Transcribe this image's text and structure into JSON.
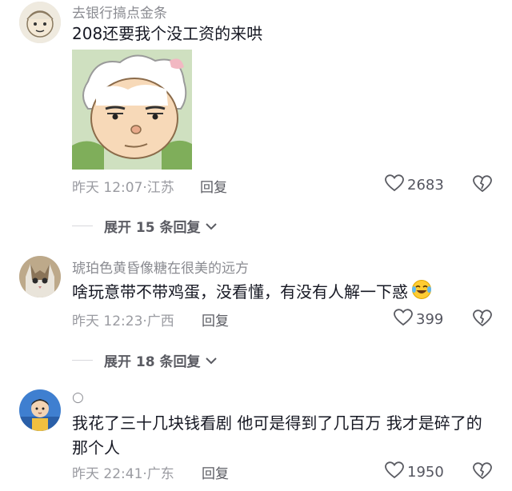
{
  "comments": [
    {
      "username": "去银行搞点金条",
      "text": "208还要我个没工资的来哄",
      "time_location": "昨天 12:07·江苏",
      "reply_label": "回复",
      "likes": "2683",
      "expand_label": "展开 15 条回复"
    },
    {
      "username": "琥珀色黄昏像糖在很美的远方",
      "text": "啥玩意带不带鸡蛋，没看懂，有没有人解一下惑",
      "time_location": "昨天 12:23·广西",
      "reply_label": "回复",
      "likes": "399",
      "expand_label": "展开 18 条回复"
    },
    {
      "username": "○",
      "text": "我花了三十几块钱看剧  他可是得到了几百万 我才是碎了的那个人",
      "time_location": "昨天 22:41·广东",
      "reply_label": "回复",
      "likes": "1950"
    }
  ],
  "icons": {
    "like": "heart-outline-icon",
    "dislike": "broken-heart-icon",
    "expand": "chevron-down-icon",
    "emoji": "crying-laughing-emoji"
  }
}
